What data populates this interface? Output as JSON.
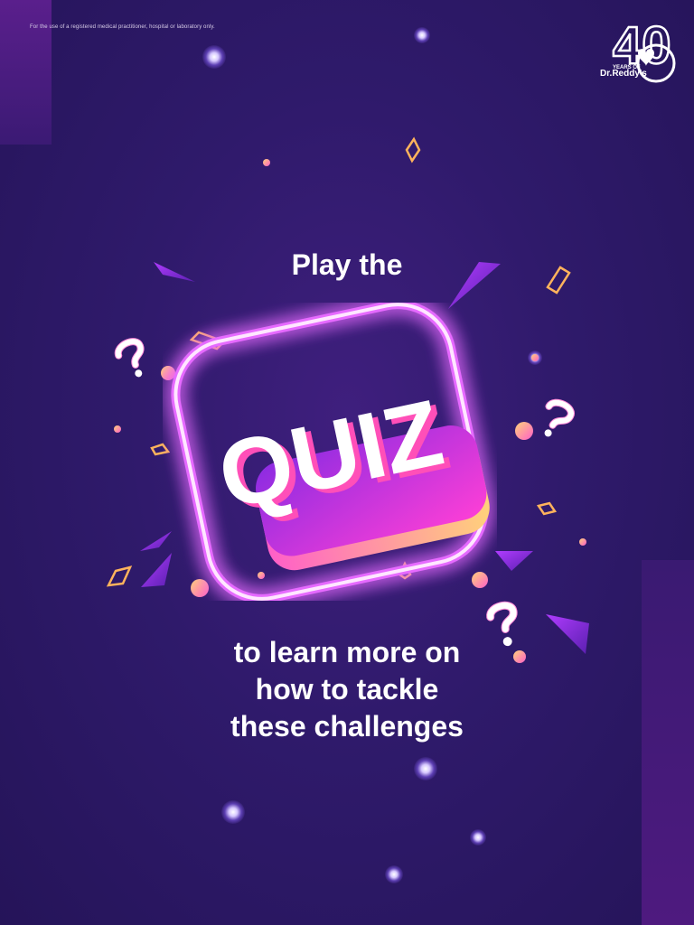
{
  "disclaimer": "For the use of a registered medical practitioner, hospital or laboratory only.",
  "logo": {
    "number": "40",
    "years_label": "YEARS OF",
    "brand": "Dr.Reddy's"
  },
  "headline": {
    "top": "Play the",
    "quiz_word": "QUIZ",
    "bottom_lines": [
      "to learn more on",
      "how to tackle",
      "these challenges"
    ]
  },
  "colors": {
    "background": "#2f1a6b",
    "accent_pink": "#ff4fd8",
    "accent_orange": "#ffb35c",
    "neon_glow": "#e66bff"
  },
  "icons": [
    "question-mark-icon",
    "diamond-confetti-icon",
    "triangle-shard-icon",
    "orb-icon",
    "sparkle-icon"
  ]
}
